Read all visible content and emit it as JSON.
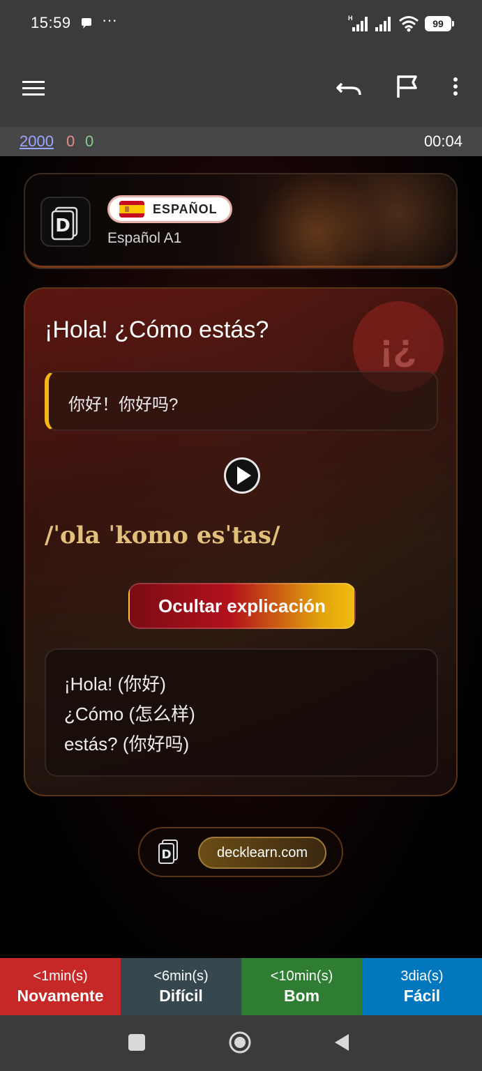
{
  "status_bar": {
    "time": "15:59",
    "more": "···",
    "battery": "99",
    "icons": [
      "chat-icon",
      "signal-h-icon",
      "signal-icon",
      "wifi-icon",
      "battery-icon"
    ]
  },
  "toolbar": {
    "icons": [
      "menu-icon",
      "undo-icon",
      "flag-icon",
      "more-vertical-icon"
    ]
  },
  "counts": {
    "new": "2000",
    "learning": "0",
    "review": "0",
    "timer": "00:04"
  },
  "deck": {
    "language_badge": "ESPAÑOL",
    "subtitle": "Español A1",
    "logo_letter": "D"
  },
  "card": {
    "question": "¡Hola! ¿Cómo estás?",
    "translation": "你好！你好吗?",
    "watermark": "¡¿",
    "ipa": "/ˈola ˈkomo esˈtas/",
    "toggle_label": "Ocultar explicación",
    "explanation": [
      "¡Hola! (你好)",
      "¿Cómo (怎么样)",
      "estás? (你好吗)"
    ]
  },
  "footer": {
    "site": "decklearn.com"
  },
  "answers": [
    {
      "interval": "<1min(s)",
      "label": "Novamente",
      "color": "#c62828"
    },
    {
      "interval": "<6min(s)",
      "label": "Difícil",
      "color": "#37474f"
    },
    {
      "interval": "<10min(s)",
      "label": "Bom",
      "color": "#2e7d32"
    },
    {
      "interval": "3dia(s)",
      "label": "Fácil",
      "color": "#0277bd"
    }
  ],
  "colors": {
    "accent_gold": "#e2c07a",
    "border_accent": "#f2b51a",
    "bar_bg": "#3b3b3b"
  }
}
